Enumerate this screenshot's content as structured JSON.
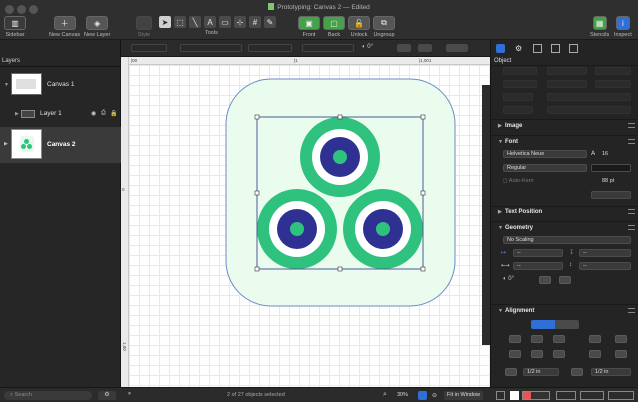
{
  "window": {
    "title": "Prototyping: Canvas 2 — Edited"
  },
  "toolbar": {
    "sidebar_label": "Sidebar",
    "new_canvas_label": "New Canvas",
    "new_layer_label": "New Layer",
    "style_label": "Style",
    "tools_label": "Tools",
    "front_label": "Front",
    "back_label": "Back",
    "unlock_label": "Unlock",
    "ungroup_label": "Ungroup",
    "stencils_label": "Stencils",
    "inspect_label": "Inspect"
  },
  "format_bar": {
    "stroke_value": "0°"
  },
  "ruler": {
    "h_ticks": [
      "|00",
      "|1",
      "|1,001"
    ],
    "v_ticks": [
      "0",
      "1,00"
    ]
  },
  "sidebar": {
    "header": "Layers",
    "canvases": [
      {
        "label": "Canvas 1"
      },
      {
        "label": "Layer 1"
      },
      {
        "label": "Canvas 2"
      }
    ]
  },
  "statusbar": {
    "search_placeholder": "Search",
    "selection_info": "2 of 27 objects selected",
    "zoom": "30%",
    "fit_label": "Fit in Window"
  },
  "inspector": {
    "object_header": "Object",
    "sections": {
      "image": "Image",
      "font": "Font",
      "text_position": "Text Position",
      "geometry": "Geometry",
      "alignment": "Alignment"
    },
    "font": {
      "family": "Helvetica Neue",
      "size": "16",
      "style": "Regular",
      "auto_kern": "Auto-Kern",
      "spacing": "88 pt"
    },
    "geometry": {
      "scaling": "No Scaling",
      "x": "--",
      "y": "--",
      "w": "--",
      "h": "--",
      "rotation": "0°"
    },
    "alignment": {
      "spacing_left": "1/2 in",
      "spacing_right": "1/2 in"
    }
  },
  "colors": {
    "green": "#2ec27e",
    "navy": "#2e3192",
    "card_fill": "#eafcee",
    "card_stroke": "#6f89c7",
    "selection": "#4a5a98",
    "accent": "#2f6fd6"
  }
}
